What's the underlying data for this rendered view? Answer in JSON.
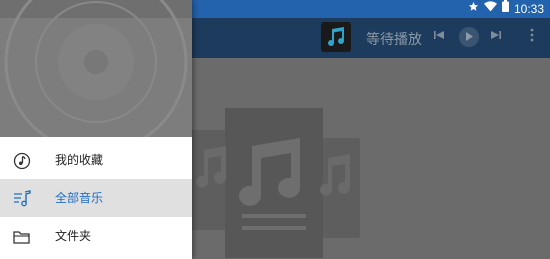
{
  "status_bar": {
    "time": "10:33",
    "icons": [
      "star-icon",
      "wifi-icon",
      "battery-icon"
    ]
  },
  "player_bar": {
    "title": "等待播放",
    "controls": [
      "previous-icon",
      "play-icon",
      "next-icon",
      "more-vert-icon"
    ]
  },
  "drawer": {
    "items": [
      {
        "label": "我的收藏",
        "icon": "favorite-music-note-icon",
        "active": false
      },
      {
        "label": "全部音乐",
        "icon": "all-music-list-icon",
        "active": true
      },
      {
        "label": "文件夹",
        "icon": "folder-icon",
        "active": false
      }
    ]
  },
  "colors": {
    "status_bar": "#2362ad",
    "accent": "#1f6fc5",
    "active_item_bg": "#e0e0e0"
  }
}
